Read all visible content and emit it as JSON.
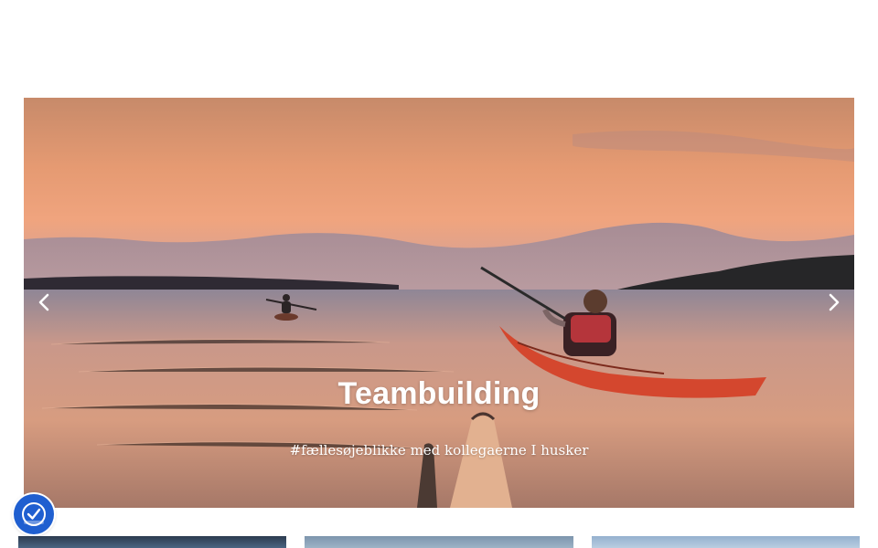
{
  "hero": {
    "title": "Teambuilding",
    "subtitle": "#fællesøjeblikke med kollegaerne I husker",
    "image_icon": "kayak-sunset-photo"
  },
  "controls": {
    "prev_icon": "chevron-left-icon",
    "next_icon": "chevron-right-icon"
  },
  "accessibility": {
    "icon": "accessibility-icon"
  },
  "thumbnails": [
    {
      "icon": "thumbnail-image"
    },
    {
      "icon": "thumbnail-image"
    },
    {
      "icon": "thumbnail-image"
    }
  ],
  "colors": {
    "accessibility_button": "#1f5fd0",
    "kayak": "#d4472e"
  }
}
